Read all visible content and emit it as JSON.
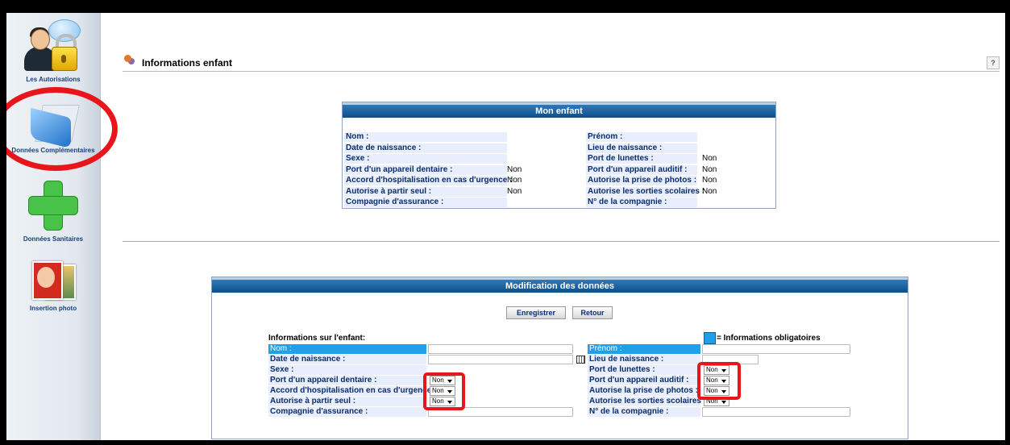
{
  "sidebar": {
    "items": [
      {
        "label": "Les Autorisations",
        "icon": "lock-user-icon"
      },
      {
        "label": "Données Complémentaires",
        "icon": "folder-icon"
      },
      {
        "label": "Données Sanitaires",
        "icon": "green-cross-icon"
      },
      {
        "label": "Insertion photo",
        "icon": "photo-icon"
      }
    ]
  },
  "header": {
    "title": "Informations enfant",
    "help": "?"
  },
  "mon_enfant": {
    "title": "Mon enfant",
    "left": [
      {
        "label": "Nom :",
        "value": ""
      },
      {
        "label": "Date de naissance :",
        "value": ""
      },
      {
        "label": "Sexe :",
        "value": ""
      },
      {
        "label": "Port d'un appareil dentaire :",
        "value": "Non"
      },
      {
        "label": "Accord d'hospitalisation en cas d'urgence :",
        "value": "Non"
      },
      {
        "label": "Autorise à partir seul :",
        "value": "Non"
      },
      {
        "label": "Compagnie d'assurance :",
        "value": ""
      }
    ],
    "right": [
      {
        "label": "Prénom :",
        "value": ""
      },
      {
        "label": "Lieu de naissance :",
        "value": ""
      },
      {
        "label": "Port de lunettes :",
        "value": "Non"
      },
      {
        "label": "Port d'un appareil auditif :",
        "value": "Non"
      },
      {
        "label": "Autorise la prise de photos :",
        "value": "Non"
      },
      {
        "label": "Autorise les sorties scolaires :",
        "value": "Non"
      },
      {
        "label": "N° de la compagnie :",
        "value": ""
      }
    ]
  },
  "modification": {
    "title": "Modification des données",
    "save_label": "Enregistrer",
    "back_label": "Retour",
    "section_label": "Informations sur l'enfant:",
    "legend": "= Informations obligatoires",
    "left": [
      {
        "label": "Nom :"
      },
      {
        "label": "Date de naissance :"
      },
      {
        "label": "Sexe :"
      },
      {
        "label": "Port d'un appareil dentaire :",
        "select": "Non"
      },
      {
        "label": "Accord d'hospitalisation en cas d'urgence :",
        "select": "Non"
      },
      {
        "label": "Autorise à partir seul :",
        "select": "Non"
      },
      {
        "label": "Compagnie d'assurance :"
      }
    ],
    "right": [
      {
        "label": "Prénom :"
      },
      {
        "label": "Lieu de naissance :"
      },
      {
        "label": "Port de lunettes :",
        "select": "Non"
      },
      {
        "label": "Port d'un appareil auditif :",
        "select": "Non"
      },
      {
        "label": "Autorise la prise de photos :",
        "select": "Non"
      },
      {
        "label": "Autorise les sorties scolaires :",
        "select": "Non"
      },
      {
        "label": "N° de la compagnie :"
      }
    ]
  },
  "colors": {
    "highlight": "#e8151b",
    "required": "#1ea0ea",
    "panel_header": "#0b4f8a"
  }
}
